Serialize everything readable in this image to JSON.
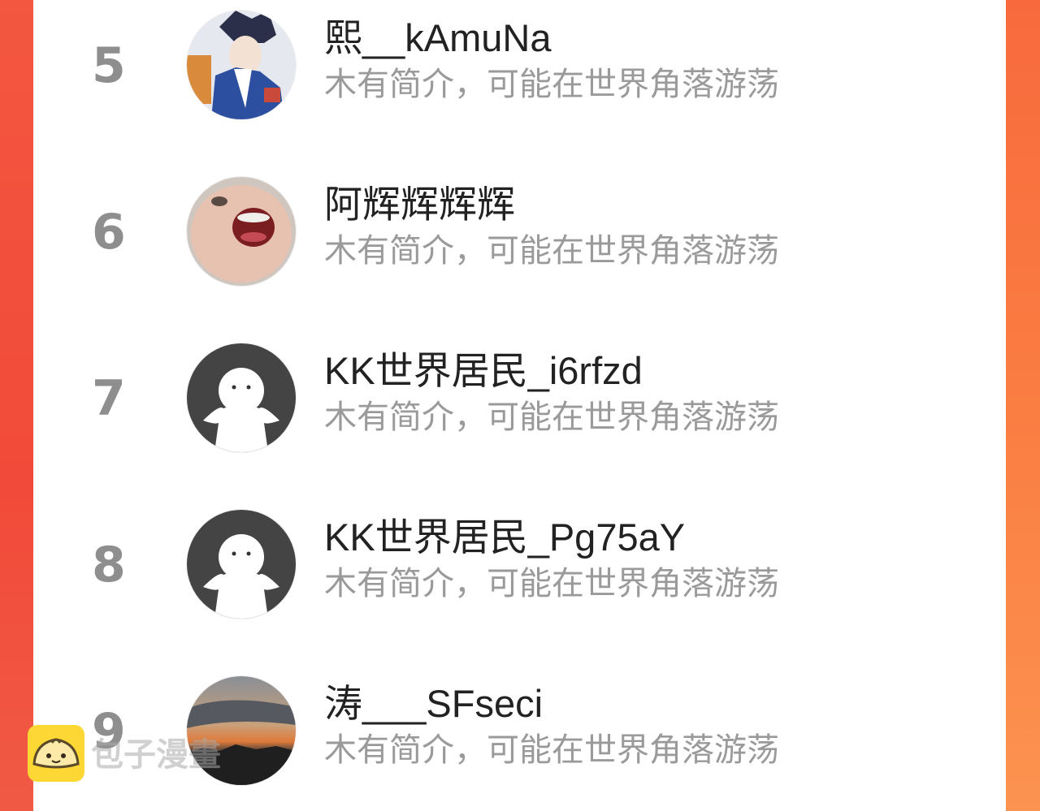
{
  "users": [
    {
      "rank": "5",
      "name": "熙__kAmuNa",
      "bio": "木有简介，可能在世界角落游荡",
      "avatar": "anime-character-avatar"
    },
    {
      "rank": "6",
      "name": "阿辉辉辉辉",
      "bio": "木有简介，可能在世界角落游荡",
      "avatar": "laughing-child-avatar"
    },
    {
      "rank": "7",
      "name": "KK世界居民_i6rfzd",
      "bio": "木有简介，可能在世界角落游荡",
      "avatar": "default-avatar"
    },
    {
      "rank": "8",
      "name": "KK世界居民_Pg75aY",
      "bio": "木有简介，可能在世界角落游荡",
      "avatar": "default-avatar"
    },
    {
      "rank": "9",
      "name": "涛___SFseci",
      "bio": "木有简介，可能在世界角落游荡",
      "avatar": "sunset-landscape-avatar"
    }
  ],
  "watermark": {
    "text": "包子漫畫",
    "icon": "bun-logo-icon"
  },
  "colors": {
    "accent_left": "#f24a3a",
    "accent_right": "#fb8a45",
    "rank": "#8e8e8e",
    "bio": "#9a9a9a",
    "name": "#222222"
  }
}
